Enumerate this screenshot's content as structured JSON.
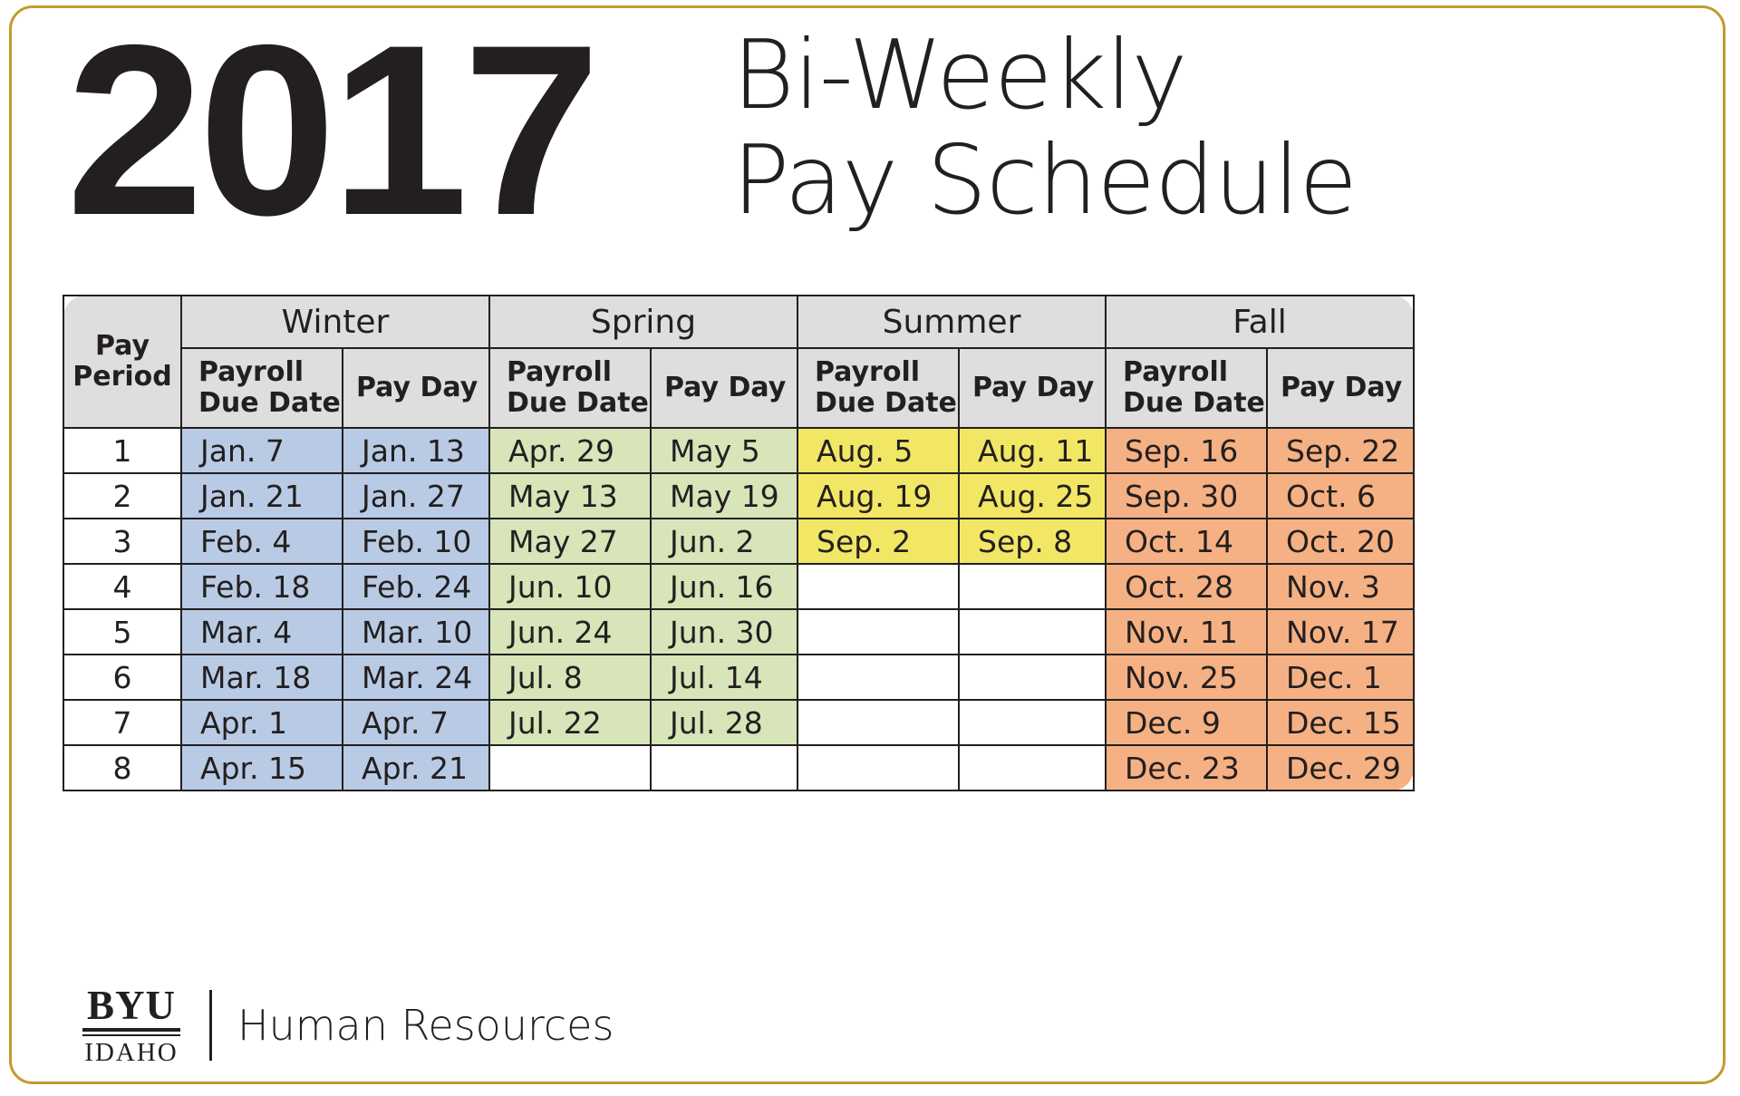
{
  "header": {
    "year": "2017",
    "title_line1": "Bi-Weekly",
    "title_line2": "Pay Schedule"
  },
  "table": {
    "period_header_line1": "Pay",
    "period_header_line2": "Period",
    "due_header_line1": "Payroll",
    "due_header_line2": "Due Date",
    "payday_header": "Pay Day",
    "seasons": [
      {
        "name": "Winter",
        "color": "#b9cbe4"
      },
      {
        "name": "Spring",
        "color": "#d7e5b9"
      },
      {
        "name": "Summer",
        "color": "#f2e765"
      },
      {
        "name": "Fall",
        "color": "#f5b183"
      }
    ],
    "periods": [
      "1",
      "2",
      "3",
      "4",
      "5",
      "6",
      "7",
      "8"
    ],
    "rows": [
      {
        "period": "1",
        "winter_due": "Jan. 7",
        "winter_pay": "Jan. 13",
        "spring_due": "Apr. 29",
        "spring_pay": "May 5",
        "summer_due": "Aug. 5",
        "summer_pay": "Aug. 11",
        "fall_due": "Sep. 16",
        "fall_pay": "Sep. 22"
      },
      {
        "period": "2",
        "winter_due": "Jan. 21",
        "winter_pay": "Jan. 27",
        "spring_due": "May 13",
        "spring_pay": "May 19",
        "summer_due": "Aug. 19",
        "summer_pay": "Aug. 25",
        "fall_due": "Sep. 30",
        "fall_pay": "Oct. 6"
      },
      {
        "period": "3",
        "winter_due": "Feb. 4",
        "winter_pay": "Feb. 10",
        "spring_due": "May 27",
        "spring_pay": "Jun. 2",
        "summer_due": "Sep. 2",
        "summer_pay": "Sep. 8",
        "fall_due": "Oct. 14",
        "fall_pay": "Oct. 20"
      },
      {
        "period": "4",
        "winter_due": "Feb. 18",
        "winter_pay": "Feb. 24",
        "spring_due": "Jun. 10",
        "spring_pay": "Jun. 16",
        "summer_due": "",
        "summer_pay": "",
        "fall_due": "Oct. 28",
        "fall_pay": "Nov. 3"
      },
      {
        "period": "5",
        "winter_due": "Mar. 4",
        "winter_pay": "Mar. 10",
        "spring_due": "Jun. 24",
        "spring_pay": "Jun. 30",
        "summer_due": "",
        "summer_pay": "",
        "fall_due": "Nov. 11",
        "fall_pay": "Nov. 17"
      },
      {
        "period": "6",
        "winter_due": "Mar. 18",
        "winter_pay": "Mar. 24",
        "spring_due": "Jul. 8",
        "spring_pay": "Jul. 14",
        "summer_due": "",
        "summer_pay": "",
        "fall_due": "Nov. 25",
        "fall_pay": "Dec. 1"
      },
      {
        "period": "7",
        "winter_due": "Apr. 1",
        "winter_pay": "Apr. 7",
        "spring_due": "Jul. 22",
        "spring_pay": "Jul. 28",
        "summer_due": "",
        "summer_pay": "",
        "fall_due": "Dec. 9",
        "fall_pay": "Dec. 15"
      },
      {
        "period": "8",
        "winter_due": "Apr. 15",
        "winter_pay": "Apr. 21",
        "spring_due": "",
        "spring_pay": "",
        "summer_due": "",
        "summer_pay": "",
        "fall_due": "Dec. 23",
        "fall_pay": "Dec. 29"
      }
    ]
  },
  "footer": {
    "logo_top": "BYU",
    "logo_bottom": "IDAHO",
    "department": "Human Resources"
  },
  "colors": {
    "card_border": "#c49a2e",
    "header_grey": "#dedede",
    "ink": "#231f20"
  }
}
